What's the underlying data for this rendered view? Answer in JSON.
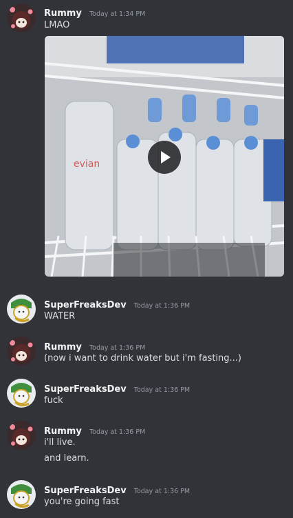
{
  "messages": [
    {
      "user": "Rummy",
      "time": "Today at 1:34 PM",
      "lines": [
        "LMAO"
      ],
      "has_video": true
    },
    {
      "user": "SuperFreaksDev",
      "time": "Today at 1:36 PM",
      "lines": [
        "WATER"
      ]
    },
    {
      "user": "Rummy",
      "time": "Today at 1:36 PM",
      "lines": [
        "(now i want to drink water but i'm fasting...)"
      ]
    },
    {
      "user": "SuperFreaksDev",
      "time": "Today at 1:36 PM",
      "lines": [
        "fuck"
      ]
    },
    {
      "user": "Rummy",
      "time": "Today at 1:36 PM",
      "lines": [
        "i'll live.",
        "and learn."
      ]
    },
    {
      "user": "SuperFreaksDev",
      "time": "Today at 1:36 PM",
      "lines": [
        "you're going fast"
      ]
    }
  ],
  "video": {
    "bottle_label": "evian",
    "play_icon": "play-icon"
  },
  "colors": {
    "background": "#313338",
    "username": "#f2f3f5",
    "timestamp": "#949ba4",
    "text": "#dbdee1"
  }
}
